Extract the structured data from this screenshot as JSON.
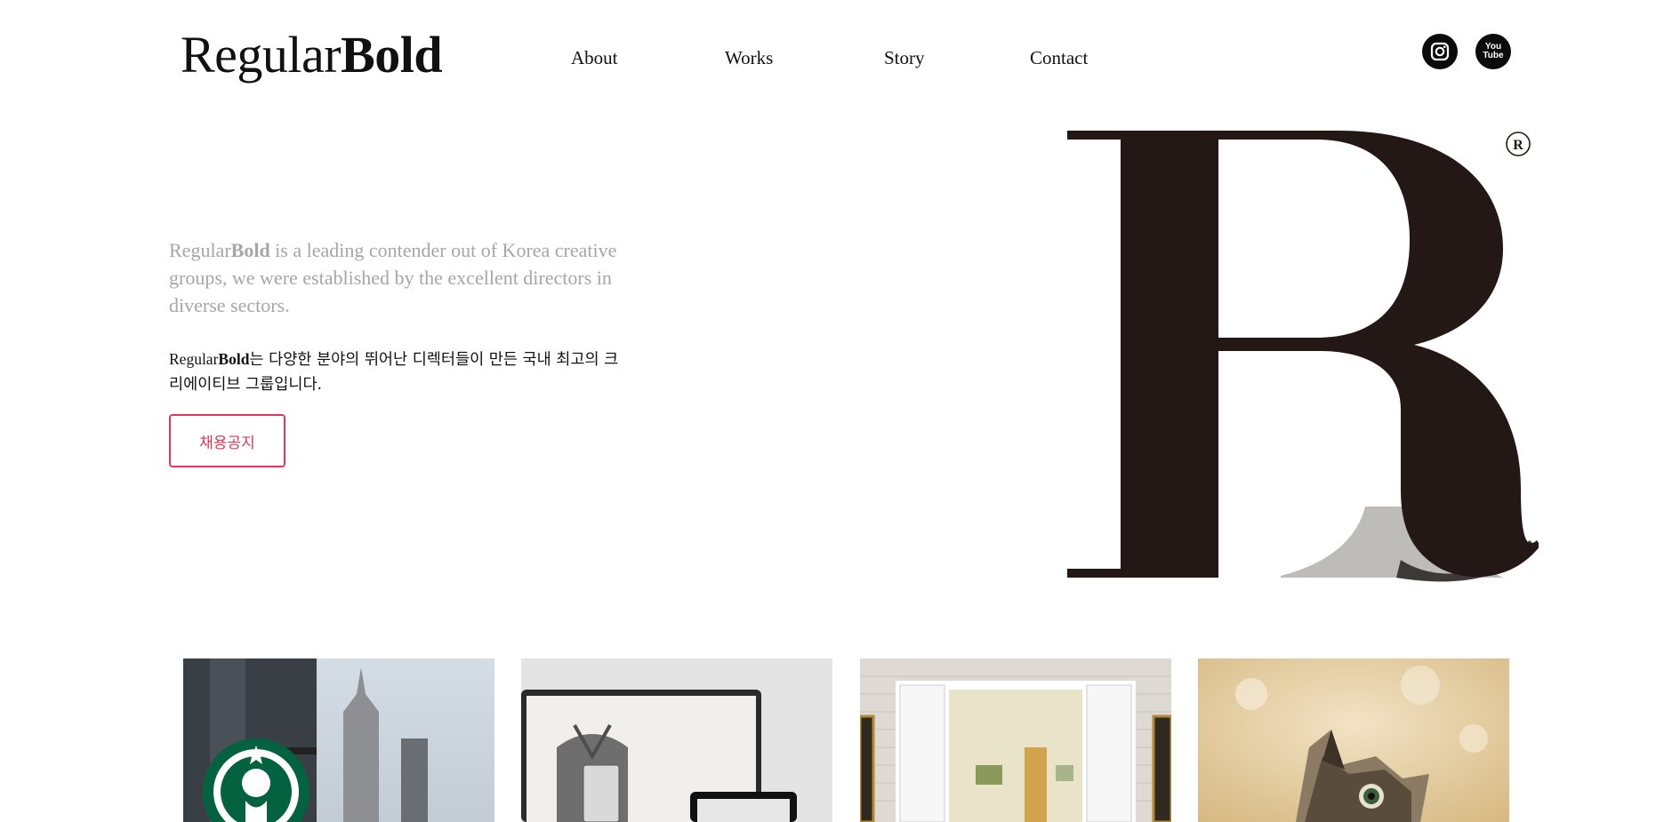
{
  "header": {
    "logo": {
      "regular": "Regular",
      "bold": "Bold"
    },
    "nav": [
      "About",
      "Works",
      "Story",
      "Contact"
    ],
    "social": [
      {
        "name": "instagram-icon"
      },
      {
        "name": "youtube-icon",
        "line1": "You",
        "line2": "Tube"
      }
    ]
  },
  "hero": {
    "intro_en": {
      "regular": "Regular",
      "bold": "Bold",
      "text": " is a leading contender out of Korea creative groups, we were established by the excellent directors in diverse sectors."
    },
    "intro_ko": {
      "regular": "Regular",
      "bold": "Bold",
      "text": "는 다양한 분야의 뛰어난 디렉터들이 만든 국내 최고의 크리에이티브 그룹입니다."
    },
    "cta_label": "채용공지",
    "mark": {
      "letter": "B",
      "registered": "R"
    }
  },
  "colors": {
    "accent": "#e0375a",
    "ink": "#231815",
    "muted": "#a6a6a6"
  },
  "works": [
    {
      "name": "starbucks-storefront-image"
    },
    {
      "name": "device-mockup-image"
    },
    {
      "name": "interior-doorway-image"
    },
    {
      "name": "kitten-image"
    }
  ]
}
